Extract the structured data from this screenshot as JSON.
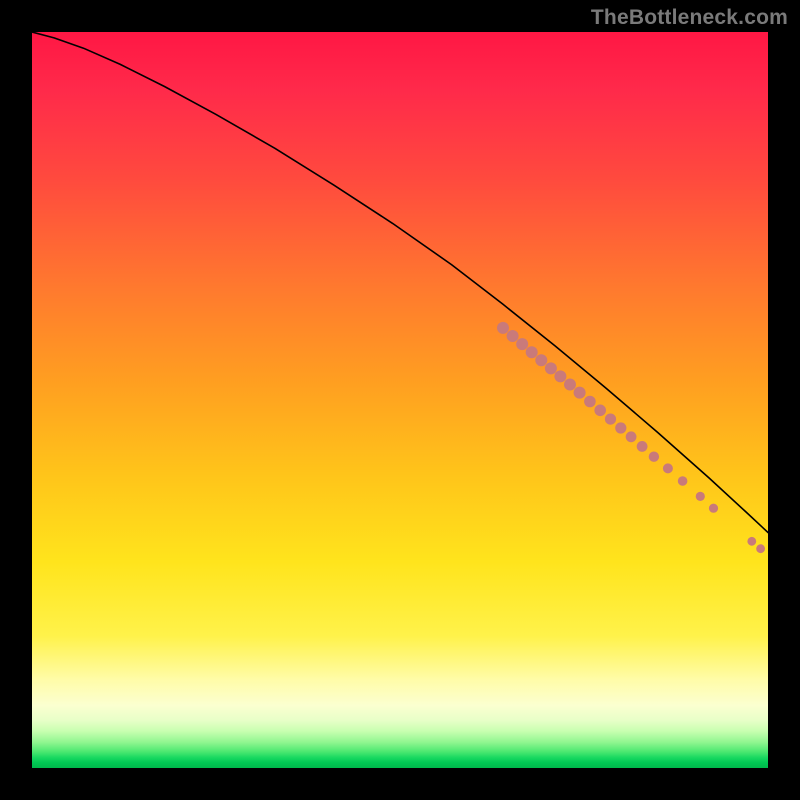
{
  "watermark": {
    "text": "TheBottleneck.com"
  },
  "chart_data": {
    "type": "line",
    "title": "",
    "xlabel": "",
    "ylabel": "",
    "xlim": [
      0,
      100
    ],
    "ylim": [
      0,
      100
    ],
    "grid": false,
    "legend": false,
    "background": "vertical-gradient red→yellow→green (green thin band at bottom)",
    "series": [
      {
        "name": "curve",
        "kind": "line",
        "x": [
          0,
          3,
          7,
          12,
          18,
          25,
          33,
          41,
          49,
          57,
          64,
          71,
          78,
          85,
          92,
          97,
          100
        ],
        "y": [
          100,
          99.2,
          97.8,
          95.6,
          92.6,
          88.8,
          84.2,
          79.2,
          74.0,
          68.4,
          63.0,
          57.4,
          51.6,
          45.6,
          39.4,
          34.8,
          32
        ]
      },
      {
        "name": "cluster-dots",
        "kind": "scatter",
        "marker": "circle",
        "color": "#c97a7a",
        "points": [
          {
            "x": 64.0,
            "y": 59.8,
            "r": 6.0
          },
          {
            "x": 65.3,
            "y": 58.7,
            "r": 6.0
          },
          {
            "x": 66.6,
            "y": 57.6,
            "r": 6.0
          },
          {
            "x": 67.9,
            "y": 56.5,
            "r": 6.0
          },
          {
            "x": 69.2,
            "y": 55.4,
            "r": 6.0
          },
          {
            "x": 70.5,
            "y": 54.3,
            "r": 6.0
          },
          {
            "x": 71.8,
            "y": 53.2,
            "r": 6.0
          },
          {
            "x": 73.1,
            "y": 52.1,
            "r": 6.0
          },
          {
            "x": 74.4,
            "y": 51.0,
            "r": 6.0
          },
          {
            "x": 75.8,
            "y": 49.8,
            "r": 5.8
          },
          {
            "x": 77.2,
            "y": 48.6,
            "r": 5.8
          },
          {
            "x": 78.6,
            "y": 47.4,
            "r": 5.6
          },
          {
            "x": 80.0,
            "y": 46.2,
            "r": 5.6
          },
          {
            "x": 81.4,
            "y": 45.0,
            "r": 5.4
          },
          {
            "x": 82.9,
            "y": 43.7,
            "r": 5.4
          },
          {
            "x": 84.5,
            "y": 42.3,
            "r": 5.2
          },
          {
            "x": 86.4,
            "y": 40.7,
            "r": 5.0
          },
          {
            "x": 88.4,
            "y": 39.0,
            "r": 4.8
          },
          {
            "x": 90.8,
            "y": 36.9,
            "r": 4.6
          },
          {
            "x": 92.6,
            "y": 35.3,
            "r": 4.6
          },
          {
            "x": 97.8,
            "y": 30.8,
            "r": 4.4
          },
          {
            "x": 99.0,
            "y": 29.8,
            "r": 4.4
          }
        ]
      }
    ]
  }
}
